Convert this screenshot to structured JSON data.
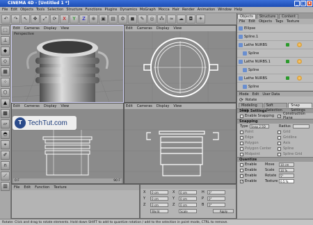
{
  "window": {
    "title": "CINEMA 4D  - [Untitled 1 *]"
  },
  "menu": [
    "File",
    "Edit",
    "Objects",
    "Tools",
    "Selection",
    "Structure",
    "Functions",
    "Plugins",
    "Dynamics",
    "MoGraph",
    "Mocca",
    "Hair",
    "Render",
    "Animation",
    "Window",
    "Help"
  ],
  "viewport_menu": [
    "Edit",
    "Cameras",
    "Display",
    "View"
  ],
  "viewports": {
    "perspective_label": "Perspective"
  },
  "watermark": {
    "logo": "T",
    "text": "TechTut.com"
  },
  "timeline": {
    "frame_start": "0 F",
    "frame_end": "90 F"
  },
  "object_manager": {
    "tabs": [
      "Objects",
      "Structure",
      "Content"
    ],
    "menu": [
      "File",
      "Edit",
      "Objects",
      "Tags",
      "Texture"
    ],
    "objects": [
      "Ellipse",
      "Spline.1",
      "Lathe NURBS",
      "Spline",
      "Lathe NURBS.1",
      "Spline",
      "Lathe NURBS",
      "Spline"
    ]
  },
  "attributes": {
    "menu": [
      "Mode",
      "Edit",
      "User Data"
    ],
    "tool_name": "Rotate",
    "tabs": [
      "Modeling Axis",
      "Soft Selection",
      "Snap Settings"
    ],
    "section_title": "Snap Settings",
    "enable_snapping": "Enable Snapping",
    "construction_plane": "Construction Plane",
    "snapping_header": "Snapping",
    "type_label": "Type",
    "type_value": "Snap 2.5D",
    "radius_label": "Radius",
    "snap_points": [
      "Point",
      "Grid",
      "Edge",
      "Gridline",
      "Polygon",
      "Axis",
      "Polygon Center",
      "Spline",
      "Midpoint",
      "Spline Grid"
    ],
    "quantize_header": "Quantize",
    "quantize_rows": [
      {
        "label": "Enable",
        "field": "Move",
        "value": "10 cm",
        "checked": false
      },
      {
        "label": "Enable",
        "field": "Scale",
        "value": "10 %",
        "checked": false
      },
      {
        "label": "Enable",
        "field": "Rotate",
        "value": "5°",
        "checked": false
      },
      {
        "label": "Enable",
        "field": "Texture",
        "value": "0.5 %",
        "checked": true
      }
    ]
  },
  "material_manager": {
    "menu": [
      "File",
      "Edit",
      "Function",
      "Texture"
    ]
  },
  "coordinates": {
    "rows": [
      {
        "a": "X",
        "av": "0 cm",
        "b": "X",
        "bv": "0 cm",
        "c": "H",
        "cv": "0°"
      },
      {
        "a": "Y",
        "av": "0 cm",
        "b": "Y",
        "bv": "0 cm",
        "c": "P",
        "cv": "0°"
      },
      {
        "a": "Z",
        "av": "0 cm",
        "b": "Z",
        "bv": "0 cm",
        "c": "B",
        "cv": "0°"
      }
    ],
    "mode1": "World",
    "mode2": "Scale",
    "apply": "Apply"
  },
  "status": "Rotate: Click and drag to rotate elements. Hold down SHIFT to add to quantize rotation / add to the selection in point mode, CTRL to remove."
}
